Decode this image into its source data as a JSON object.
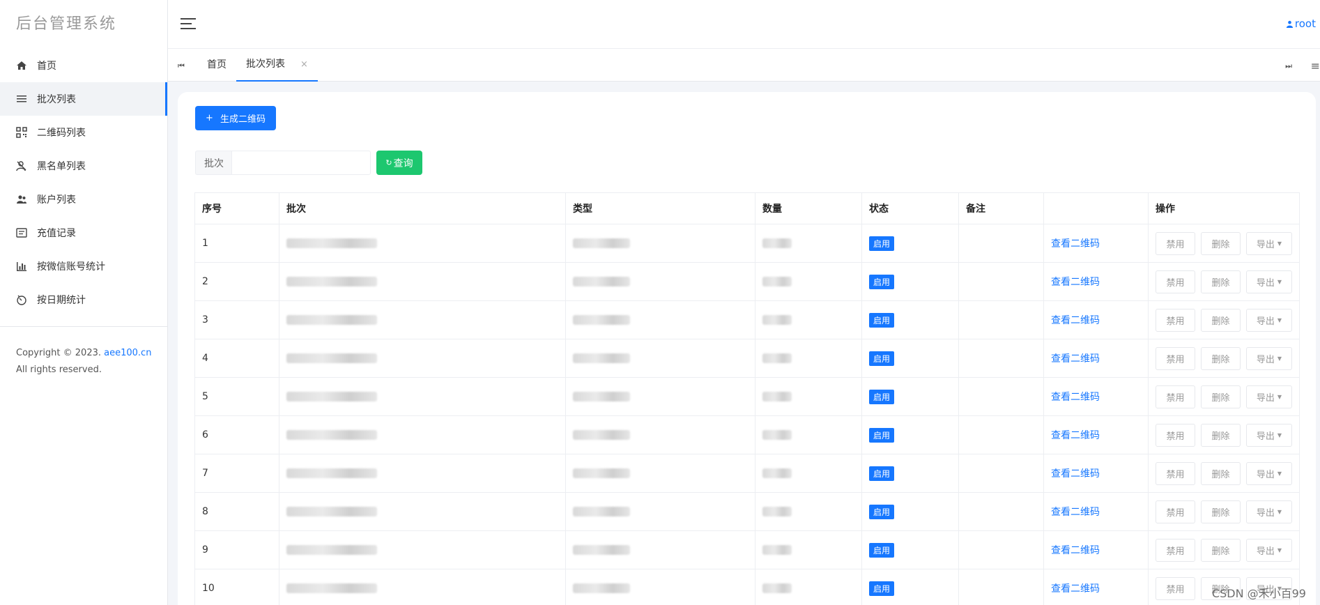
{
  "app": {
    "brand": "后台管理系统",
    "user": "root"
  },
  "sidebar": {
    "items": [
      {
        "label": "首页",
        "icon": "home-icon"
      },
      {
        "label": "批次列表",
        "icon": "list-icon",
        "active": true
      },
      {
        "label": "二维码列表",
        "icon": "qrcode-icon"
      },
      {
        "label": "黑名单列表",
        "icon": "user-blocked-icon"
      },
      {
        "label": "账户列表",
        "icon": "users-icon"
      },
      {
        "label": "充值记录",
        "icon": "record-icon"
      },
      {
        "label": "按微信账号统计",
        "icon": "bar-chart-icon"
      },
      {
        "label": "按日期统计",
        "icon": "timer-icon"
      }
    ],
    "copyright_prefix": "Copyright © 2023. ",
    "copyright_link": "aee100.cn",
    "copyright_suffix": "All rights reserved."
  },
  "tabs": [
    {
      "label": "首页",
      "closable": false
    },
    {
      "label": "批次列表",
      "closable": true,
      "active": true
    }
  ],
  "toolbar": {
    "create_label": "生成二维码",
    "search_label": "批次",
    "search_placeholder": "",
    "search_button": "查询"
  },
  "table": {
    "columns": [
      "序号",
      "批次",
      "类型",
      "数量",
      "状态",
      "备注",
      "",
      "操作"
    ],
    "rows": [
      {
        "index": "1"
      },
      {
        "index": "2"
      },
      {
        "index": "3"
      },
      {
        "index": "4"
      },
      {
        "index": "5"
      },
      {
        "index": "6"
      },
      {
        "index": "7"
      },
      {
        "index": "8"
      },
      {
        "index": "9"
      },
      {
        "index": "10"
      }
    ],
    "status_label": "启用",
    "view_link": "查看二维码",
    "disable_label": "禁用",
    "delete_label": "删除",
    "export_label": "导出"
  },
  "watermark": "CSDN @禾小百99",
  "colors": {
    "accent": "#1677ff",
    "search": "#1dc76f"
  }
}
